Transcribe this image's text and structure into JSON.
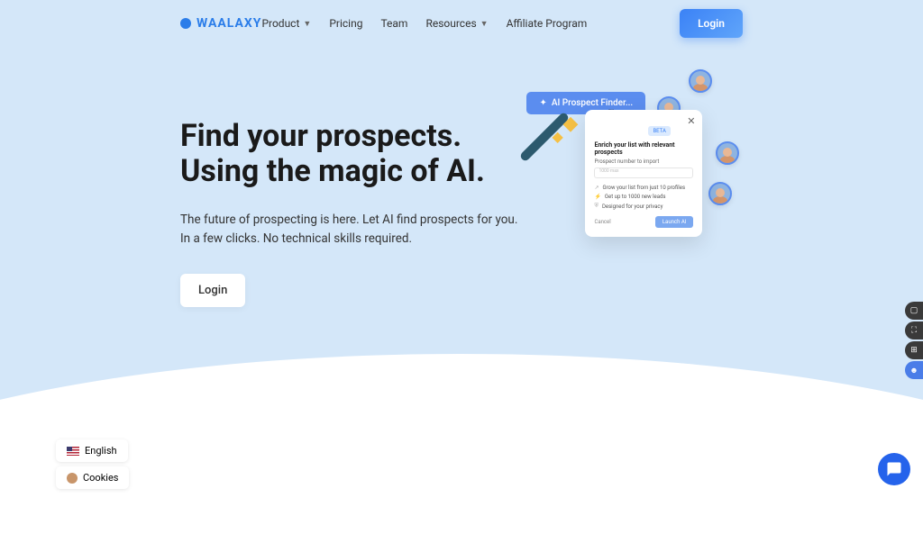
{
  "brand": "WAALAXY",
  "nav": {
    "product": "Product",
    "pricing": "Pricing",
    "team": "Team",
    "resources": "Resources",
    "affiliate": "Affiliate Program"
  },
  "login_top": "Login",
  "hero": {
    "title_l1": "Find your prospects.",
    "title_l2": "Using the magic of AI.",
    "sub_l1": "The future of prospecting is here. Let AI find prospects for you.",
    "sub_l2": "In a few clicks. No technical skills required.",
    "cta": "Login"
  },
  "widget": {
    "pill": "AI Prospect Finder...",
    "badge": "BETA",
    "title": "Enrich your list with relevant prospects",
    "label": "Prospect number to import",
    "placeholder": "1000 max",
    "features": [
      "Grow your list from just 10 profiles",
      "Get up to 1000 new leads",
      "Designed for your privacy"
    ],
    "cancel": "Cancel",
    "launch": "Launch AI"
  },
  "footer": {
    "language": "English",
    "cookies": "Cookies"
  }
}
